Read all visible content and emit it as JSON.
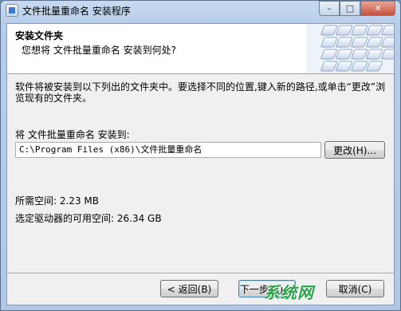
{
  "window": {
    "title": "文件批量重命名 安装程序",
    "buttons": {
      "minimize": "–",
      "maximize": "□",
      "close": "✕"
    }
  },
  "header": {
    "title": "安装文件夹",
    "subtitle": "您想将 文件批量重命名 安装到何处?"
  },
  "body": {
    "description": "软件将被安装到以下列出的文件夹中。要选择不同的位置,键入新的路径,或单击“更改”浏览现有的文件夹。",
    "install_label": "将 文件批量重命名 安装到:",
    "install_path": "C:\\Program Files (x86)\\文件批量重命名",
    "browse_label": "更改(H)...",
    "space_required": "所需空间: 2.23 MB",
    "space_available": "选定驱动器的可用空间: 26.34 GB"
  },
  "footer": {
    "back_label": "< 返回(B)",
    "next_label": "下一步(N) >",
    "cancel_label": "取消(C)"
  },
  "watermark": "系统网",
  "colors": {
    "header_bg": "#ffffff",
    "panel_bg": "#f0f0f0",
    "title_bar": "#b6cde9",
    "watermark": "#2da34a"
  }
}
